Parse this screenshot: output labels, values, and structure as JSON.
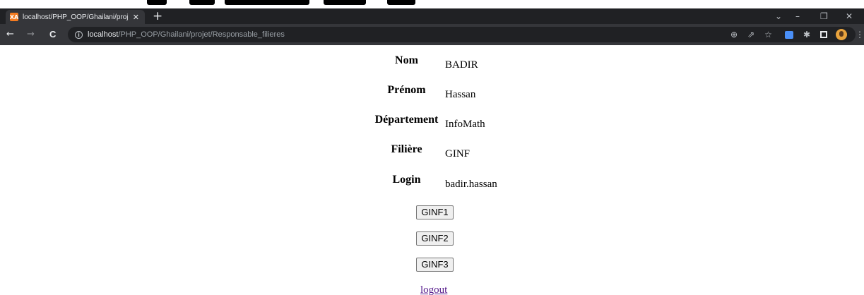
{
  "browser": {
    "tab": {
      "title": "localhost/PHP_OOP/Ghailani/proj",
      "close": "✕",
      "favicon": "XA"
    },
    "new_tab": "+",
    "window_controls": {
      "dropdown": "⌄",
      "minimize": "–",
      "restore": "❐",
      "close": "✕"
    },
    "nav": {
      "back": "←",
      "forward": "→",
      "reload": "C"
    },
    "address": {
      "host": "localhost",
      "path": "/PHP_OOP/Ghailani/projet/Responsable_filieres",
      "info_icon": "i"
    },
    "toolbar_icons": {
      "zoom": "⊕",
      "share": "⇗",
      "bookmark": "☆",
      "extensions": "✱",
      "menu": "⋮"
    }
  },
  "profile": {
    "fields": [
      {
        "label": "Nom",
        "value": "BADIR"
      },
      {
        "label": "Prénom",
        "value": "Hassan"
      },
      {
        "label": "Département",
        "value": "InfoMath"
      },
      {
        "label": "Filière",
        "value": "GINF"
      },
      {
        "label": "Login",
        "value": "badir.hassan"
      }
    ]
  },
  "filieres": {
    "buttons": [
      "GINF1",
      "GINF2",
      "GINF3"
    ]
  },
  "logout_label": "logout"
}
